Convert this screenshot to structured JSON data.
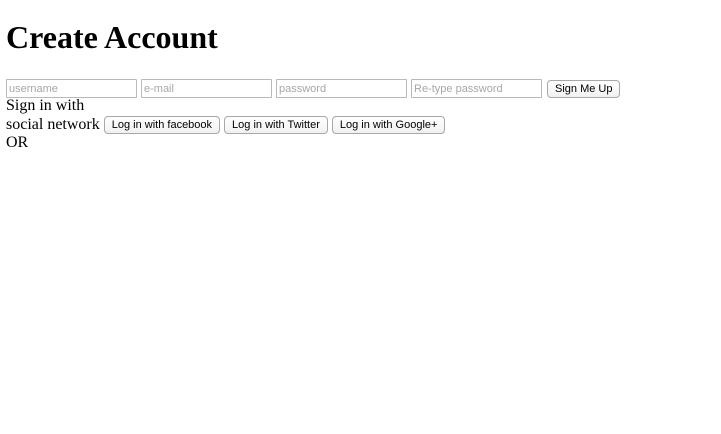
{
  "page": {
    "title": "Create Account"
  },
  "signup": {
    "username_placeholder": "username",
    "email_placeholder": "e-mail",
    "password_placeholder": "password",
    "retype_password_placeholder": "Re-type password",
    "submit_label": "Sign Me Up"
  },
  "social": {
    "label_line1": "Sign in with",
    "label_line2": "social network",
    "facebook_label": "Log in with facebook",
    "twitter_label": "Log in with Twitter",
    "google_label": "Log in with Google+"
  },
  "divider": {
    "or_text": "OR"
  }
}
